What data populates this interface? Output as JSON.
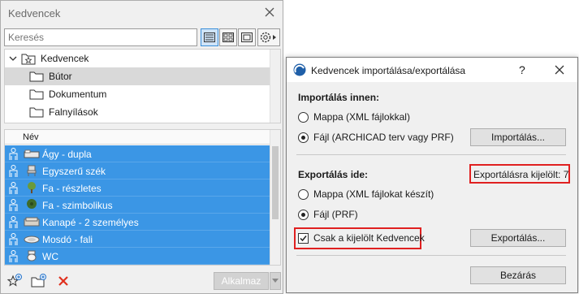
{
  "favorites_panel": {
    "title": "Kedvencek",
    "search_placeholder": "Keresés",
    "tree": [
      {
        "label": "Kedvencek",
        "type": "root"
      },
      {
        "label": "Bútor",
        "type": "folder",
        "selected": true
      },
      {
        "label": "Dokumentum",
        "type": "folder"
      },
      {
        "label": "Falnyílások",
        "type": "folder"
      }
    ],
    "list_header": "Név",
    "items": [
      {
        "name": "Ágy - dupla",
        "icon": "bed-icon"
      },
      {
        "name": "Egyszerű szék",
        "icon": "chair-icon"
      },
      {
        "name": "Fa - részletes",
        "icon": "tree-detailed-icon"
      },
      {
        "name": "Fa - szimbolikus",
        "icon": "tree-symbolic-icon"
      },
      {
        "name": "Kanapé - 2 személyes",
        "icon": "sofa-icon"
      },
      {
        "name": "Mosdó - fali",
        "icon": "sink-icon"
      },
      {
        "name": "WC",
        "icon": "wc-icon"
      }
    ],
    "apply_label": "Alkalmaz"
  },
  "dialog": {
    "title": "Kedvencek importálása/exportálása",
    "help": "?",
    "import_section": {
      "label": "Importálás innen:",
      "options": [
        {
          "label": "Mappa (XML fájlokkal)",
          "checked": false
        },
        {
          "label": "Fájl (ARCHICAD terv vagy PRF)",
          "checked": true
        }
      ],
      "button": "Importálás..."
    },
    "export_section": {
      "label": "Exportálás ide:",
      "selected_count": "Exportálásra kijelölt: 7",
      "options": [
        {
          "label": "Mappa (XML fájlokat készít)",
          "checked": false
        },
        {
          "label": "Fájl (PRF)",
          "checked": true
        }
      ],
      "checkbox": {
        "label": "Csak a kijelölt Kedvencek",
        "checked": true
      },
      "button": "Exportálás..."
    },
    "close_button": "Bezárás"
  },
  "colors": {
    "selection": "#3b96e5",
    "highlight": "#e02020",
    "tree_selected": "#d9d9d9"
  }
}
